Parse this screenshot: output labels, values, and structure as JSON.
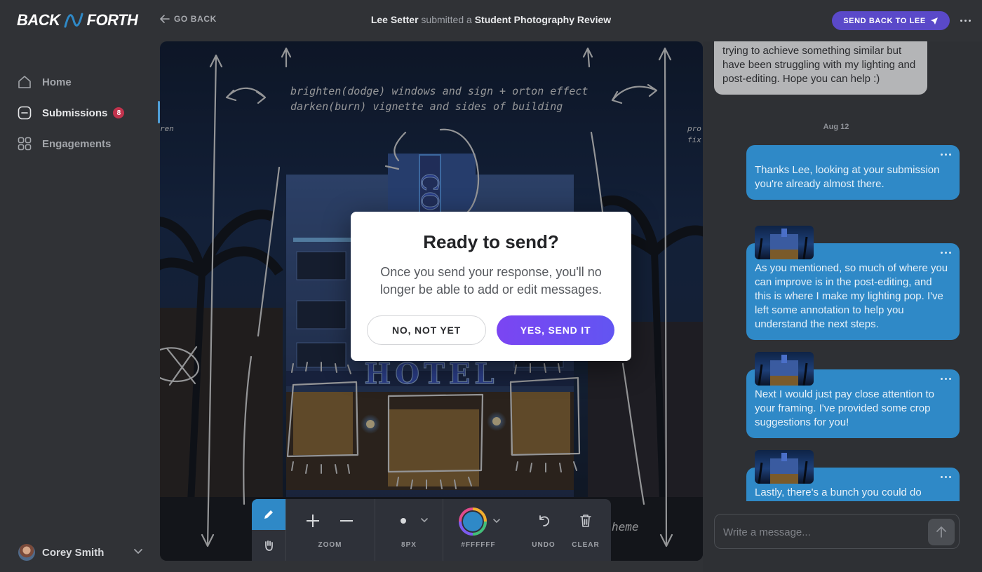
{
  "app": {
    "logo_left": "BACK",
    "logo_right": "FORTH"
  },
  "header": {
    "go_back": "GO BACK",
    "submitter": "Lee Setter",
    "submitted_text": "submitted a",
    "submission_type": "Student Photography Review",
    "send_back_label": "SEND BACK TO LEE"
  },
  "sidebar": {
    "items": [
      {
        "label": "Home",
        "icon": "home-icon"
      },
      {
        "label": "Submissions",
        "icon": "inbox-icon",
        "badge": "8"
      },
      {
        "label": "Engagements",
        "icon": "grid-icon"
      }
    ],
    "user_name": "Corey Smith"
  },
  "canvas": {
    "annotation_line1": "brighten(dodge) windows and sign + orton effect",
    "annotation_line2": "darken(burn) vignette and sides of building",
    "sign_top": "CO",
    "sign_bottom": "HOTEL",
    "edge_left": "ren",
    "edge_right_1": "pro",
    "edge_right_2": "fix",
    "bottom_note": "heme"
  },
  "toolbar": {
    "zoom_label": "ZOOM",
    "size_label": "8PX",
    "color_label": "#FFFFFF",
    "undo_label": "UNDO",
    "clear_label": "CLEAR",
    "accent_color": "#2f89c7"
  },
  "chat": {
    "incoming_text": "trying to achieve something similar but have been struggling with my lighting and post-editing. Hope you can help :)",
    "date_separator": "Aug 12",
    "messages": [
      {
        "text": "Thanks Lee, looking at your submission you're already almost there."
      },
      {
        "text": "As you mentioned, so much of where you can improve is in the post-editing, and this is where I make my lighting pop. I've left some annotation to help you understand the next steps."
      },
      {
        "text": "Next I would just pay close attention to your framing. I've provided some crop suggestions for you!"
      },
      {
        "text": "Lastly, there's a bunch you could do"
      }
    ],
    "composer_placeholder": "Write a message..."
  },
  "modal": {
    "title": "Ready to send?",
    "body": "Once you send your response, you'll no longer be able to add or edit messages.",
    "cancel_label": "NO, NOT YET",
    "confirm_label": "YES, SEND IT"
  }
}
